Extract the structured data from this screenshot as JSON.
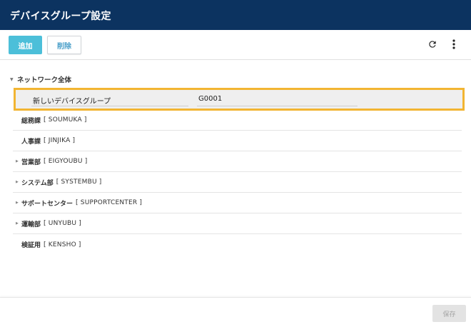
{
  "header": {
    "title": "デバイスグループ設定"
  },
  "toolbar": {
    "add_label": "追加",
    "delete_label": "削除",
    "refresh_icon": "refresh-icon",
    "more_icon": "more-vertical-icon"
  },
  "tree": {
    "root_label": "ネットワーク全体",
    "editing": {
      "name_value": "新しいデバイスグループ",
      "code_value": "G0001"
    },
    "nodes": [
      {
        "label": "総務課",
        "code": "[ SOUMUKA ]",
        "expandable": false
      },
      {
        "label": "人事課",
        "code": "[ JINJIKA ]",
        "expandable": false
      },
      {
        "label": "営業部",
        "code": "[ EIGYOUBU ]",
        "expandable": true
      },
      {
        "label": "システム部",
        "code": "[ SYSTEMBU ]",
        "expandable": true
      },
      {
        "label": "サポートセンター",
        "code": "[ SUPPORTCENTER ]",
        "expandable": true
      },
      {
        "label": "運輸部",
        "code": "[ UNYUBU ]",
        "expandable": true
      },
      {
        "label": "検証用",
        "code": "[ KENSHO ]",
        "expandable": false
      }
    ]
  },
  "footer": {
    "save_label": "保存"
  },
  "colors": {
    "header_bg": "#0c3360",
    "accent": "#4cbfd9",
    "edit_highlight": "#f2b532"
  }
}
